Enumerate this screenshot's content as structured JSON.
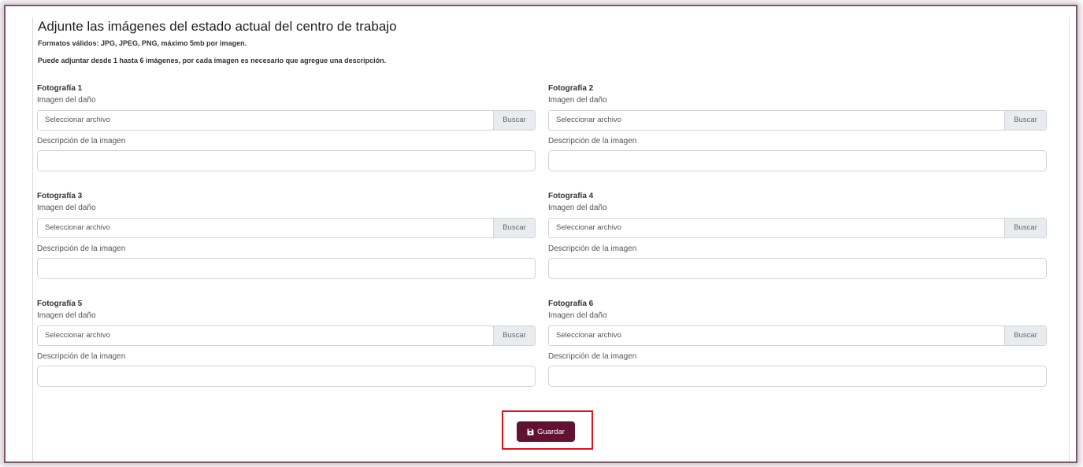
{
  "form": {
    "title": "Adjunte las imágenes del estado actual del centro de trabajo",
    "formats_note": "Formatos válidos: JPG, JPEG, PNG, máximo 5mb por imagen.",
    "instructions": "Puede adjuntar desde 1 hasta 6 imágenes, por cada imagen es necesario que agregue una descripción.",
    "photos": [
      {
        "title": "Fotografía 1",
        "image_label": "Imagen del daño",
        "file_placeholder": "Seleccionar archivo",
        "browse_label": "Buscar",
        "description_label": "Descripción de la imagen",
        "description_value": ""
      },
      {
        "title": "Fotografía 2",
        "image_label": "Imagen del daño",
        "file_placeholder": "Seleccionar archivo",
        "browse_label": "Buscar",
        "description_label": "Descripción de la imagen",
        "description_value": ""
      },
      {
        "title": "Fotografía 3",
        "image_label": "Imagen del daño",
        "file_placeholder": "Seleccionar archivo",
        "browse_label": "Buscar",
        "description_label": "Descripción de la imagen",
        "description_value": ""
      },
      {
        "title": "Fotografía 4",
        "image_label": "Imagen del daño",
        "file_placeholder": "Seleccionar archivo",
        "browse_label": "Buscar",
        "description_label": "Descripción de la imagen",
        "description_value": ""
      },
      {
        "title": "Fotografía 5",
        "image_label": "Imagen del daño",
        "file_placeholder": "Seleccionar archivo",
        "browse_label": "Buscar",
        "description_label": "Descripción de la imagen",
        "description_value": ""
      },
      {
        "title": "Fotografía 6",
        "image_label": "Imagen del daño",
        "file_placeholder": "Seleccionar archivo",
        "browse_label": "Buscar",
        "description_label": "Descripción de la imagen",
        "description_value": ""
      }
    ],
    "save_label": "Guardar",
    "save_icon": "floppy-disk-icon"
  },
  "colors": {
    "primary_button": "#611232",
    "highlight_border": "#e0141c",
    "frame_border": "#7a5a66"
  }
}
